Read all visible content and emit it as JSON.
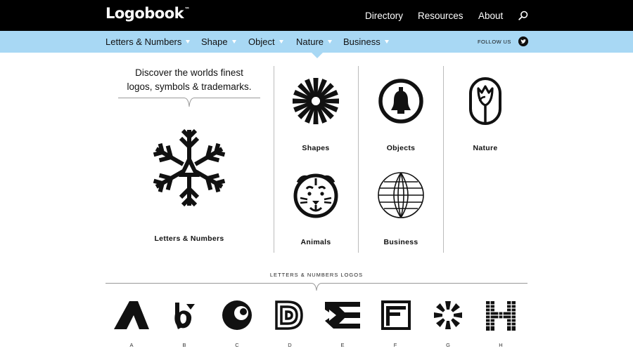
{
  "header": {
    "logo_text": "Logobook",
    "logo_mark": "™",
    "nav": [
      "Directory",
      "Resources",
      "About"
    ],
    "search_icon": "search-icon"
  },
  "categories": {
    "items": [
      "Letters & Numbers",
      "Shape",
      "Object",
      "Nature",
      "Business"
    ],
    "follow_label": "FOLLOW US",
    "social_icon": "twitter-icon"
  },
  "hero": {
    "tagline_line1": "Discover the worlds finest",
    "tagline_line2": "logos, symbols & trademarks.",
    "featured_label": "Letters & Numbers",
    "featured_icon": "snowflake-a-logo-icon"
  },
  "tiles": [
    {
      "label": "Shapes",
      "icon": "starburst-logo-icon"
    },
    {
      "label": "Objects",
      "icon": "bell-logo-icon"
    },
    {
      "label": "Nature",
      "icon": "tulip-logo-icon"
    },
    {
      "label": "Animals",
      "icon": "tiger-logo-icon"
    },
    {
      "label": "Business",
      "icon": "globe-logo-icon"
    }
  ],
  "letters_section": {
    "title": "LETTERS & NUMBERS LOGOS",
    "letters": [
      "A",
      "B",
      "C",
      "D",
      "E",
      "F",
      "G",
      "H"
    ]
  },
  "colors": {
    "header_bg": "#000000",
    "category_bar": "#a8d8f4",
    "text": "#111111"
  }
}
